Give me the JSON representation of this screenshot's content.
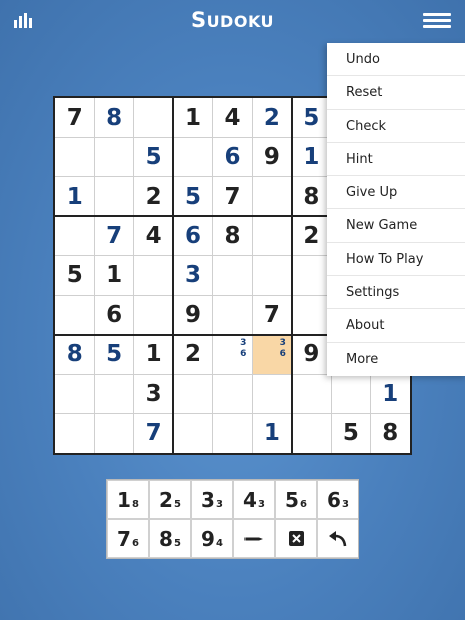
{
  "app": {
    "title_big": "S",
    "title_rest": "UDOKU",
    "icons": {
      "stats": "bar-chart-icon",
      "menu": "hamburger-menu-icon"
    }
  },
  "menu": {
    "items": [
      "Undo",
      "Reset",
      "Check",
      "Hint",
      "Give Up",
      "New Game",
      "How To Play",
      "Settings",
      "About",
      "More"
    ]
  },
  "board": {
    "rows": [
      [
        {
          "v": "7",
          "t": "g"
        },
        {
          "v": "8",
          "t": "u"
        },
        {
          "v": "",
          "t": "e"
        },
        {
          "v": "1",
          "t": "g"
        },
        {
          "v": "4",
          "t": "g"
        },
        {
          "v": "2",
          "t": "u"
        },
        {
          "v": "5",
          "t": "u"
        },
        {
          "v": "",
          "t": "e"
        },
        {
          "v": "",
          "t": "e"
        }
      ],
      [
        {
          "v": "",
          "t": "e"
        },
        {
          "v": "",
          "t": "e"
        },
        {
          "v": "5",
          "t": "u"
        },
        {
          "v": "",
          "t": "e"
        },
        {
          "v": "6",
          "t": "u"
        },
        {
          "v": "9",
          "t": "g"
        },
        {
          "v": "1",
          "t": "u"
        },
        {
          "v": "",
          "t": "e"
        },
        {
          "v": "",
          "t": "e"
        }
      ],
      [
        {
          "v": "1",
          "t": "u"
        },
        {
          "v": "",
          "t": "e"
        },
        {
          "v": "2",
          "t": "g"
        },
        {
          "v": "5",
          "t": "u"
        },
        {
          "v": "7",
          "t": "g"
        },
        {
          "v": "",
          "t": "e"
        },
        {
          "v": "8",
          "t": "g"
        },
        {
          "v": "",
          "t": "e"
        },
        {
          "v": "",
          "t": "e"
        }
      ],
      [
        {
          "v": "",
          "t": "e"
        },
        {
          "v": "7",
          "t": "u"
        },
        {
          "v": "4",
          "t": "g"
        },
        {
          "v": "6",
          "t": "u"
        },
        {
          "v": "8",
          "t": "g"
        },
        {
          "v": "",
          "t": "e"
        },
        {
          "v": "2",
          "t": "g"
        },
        {
          "v": "",
          "t": "e"
        },
        {
          "v": "",
          "t": "e"
        }
      ],
      [
        {
          "v": "5",
          "t": "g"
        },
        {
          "v": "1",
          "t": "g"
        },
        {
          "v": "",
          "t": "e"
        },
        {
          "v": "3",
          "t": "u"
        },
        {
          "v": "",
          "t": "e"
        },
        {
          "v": "",
          "t": "e"
        },
        {
          "v": "",
          "t": "e"
        },
        {
          "v": "",
          "t": "e"
        },
        {
          "v": "",
          "t": "e"
        }
      ],
      [
        {
          "v": "",
          "t": "e"
        },
        {
          "v": "6",
          "t": "g"
        },
        {
          "v": "",
          "t": "e"
        },
        {
          "v": "9",
          "t": "g"
        },
        {
          "v": "",
          "t": "e"
        },
        {
          "v": "7",
          "t": "g"
        },
        {
          "v": "",
          "t": "e"
        },
        {
          "v": "",
          "t": "e"
        },
        {
          "v": "",
          "t": "e"
        }
      ],
      [
        {
          "v": "8",
          "t": "u"
        },
        {
          "v": "5",
          "t": "u"
        },
        {
          "v": "1",
          "t": "g"
        },
        {
          "v": "2",
          "t": "g"
        },
        {
          "v": "",
          "t": "n",
          "notes": [
            "3",
            "6"
          ]
        },
        {
          "v": "",
          "t": "n",
          "notes": [
            "3",
            "6"
          ],
          "selected": true
        },
        {
          "v": "9",
          "t": "g"
        },
        {
          "v": "",
          "t": "e"
        },
        {
          "v": "",
          "t": "e"
        }
      ],
      [
        {
          "v": "",
          "t": "e"
        },
        {
          "v": "",
          "t": "e"
        },
        {
          "v": "3",
          "t": "g"
        },
        {
          "v": "",
          "t": "e"
        },
        {
          "v": "",
          "t": "e"
        },
        {
          "v": "",
          "t": "e"
        },
        {
          "v": "",
          "t": "e"
        },
        {
          "v": "",
          "t": "e"
        },
        {
          "v": "1",
          "t": "u"
        }
      ],
      [
        {
          "v": "",
          "t": "e"
        },
        {
          "v": "",
          "t": "e"
        },
        {
          "v": "7",
          "t": "u"
        },
        {
          "v": "",
          "t": "e"
        },
        {
          "v": "",
          "t": "e"
        },
        {
          "v": "1",
          "t": "u"
        },
        {
          "v": "",
          "t": "e"
        },
        {
          "v": "5",
          "t": "g"
        },
        {
          "v": "8",
          "t": "g"
        }
      ]
    ]
  },
  "keypad": {
    "keys": [
      {
        "num": "1",
        "count": "8"
      },
      {
        "num": "2",
        "count": "5"
      },
      {
        "num": "3",
        "count": "3"
      },
      {
        "num": "4",
        "count": "3"
      },
      {
        "num": "5",
        "count": "6"
      },
      {
        "num": "6",
        "count": "3"
      },
      {
        "num": "7",
        "count": "6"
      },
      {
        "num": "8",
        "count": "5"
      },
      {
        "num": "9",
        "count": "4"
      },
      {
        "icon": "pencil-icon"
      },
      {
        "icon": "erase-icon"
      },
      {
        "icon": "undo-arrow-icon"
      }
    ]
  }
}
